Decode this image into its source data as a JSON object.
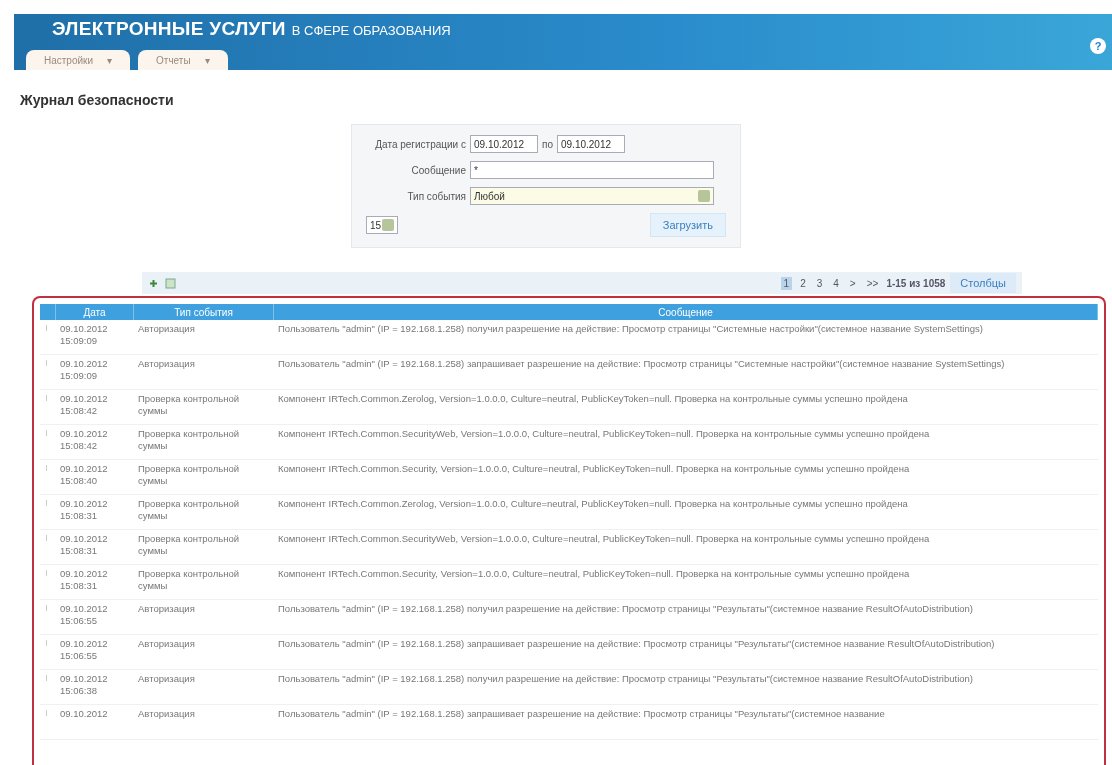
{
  "header": {
    "title_bold": "ЭЛЕКТРОННЫЕ УСЛУГИ",
    "title_rest": "В СФЕРЕ ОБРАЗОВАНИЯ",
    "help": "?"
  },
  "menu": [
    {
      "label": "Настройки",
      "caret": "▾"
    },
    {
      "label": "Отчеты",
      "caret": "▾"
    }
  ],
  "page_title": "Журнал безопасности",
  "filter": {
    "date_label": "Дата регистрации с",
    "date_from": "09.10.2012",
    "date_to_label": "по",
    "date_to": "09.10.2012",
    "message_label": "Сообщение",
    "message_value": "*",
    "type_label": "Тип события",
    "type_value": "Любой",
    "page_size": "15",
    "load_button": "Загрузить"
  },
  "pager": {
    "pages": [
      {
        "label": "1",
        "selected": true
      },
      {
        "label": "2",
        "selected": false
      },
      {
        "label": "3",
        "selected": false
      },
      {
        "label": "4",
        "selected": false
      }
    ],
    "next": ">",
    "last": ">>",
    "range": "1-15 из 1058",
    "columns_button": "Столбцы"
  },
  "table": {
    "columns": [
      "Дата",
      "Тип события",
      "Сообщение"
    ],
    "rows": [
      {
        "date": "09.10.2012 15:09:09",
        "type": "Авторизация",
        "message": "Пользователь \"admin\" (IP = 192.168.1.258) получил разрешение на действие: Просмотр страницы \"Системные настройки\"(системное название SystemSettings)"
      },
      {
        "date": "09.10.2012 15:09:09",
        "type": "Авторизация",
        "message": "Пользователь \"admin\" (IP = 192.168.1.258) запрашивает разрешение на действие: Просмотр страницы \"Системные настройки\"(системное название SystemSettings)"
      },
      {
        "date": "09.10.2012 15:08:42",
        "type": "Проверка контрольной суммы",
        "message": "Компонент IRTech.Common.Zerolog, Version=1.0.0.0, Culture=neutral, PublicKeyToken=null. Проверка на контрольные суммы успешно пройдена"
      },
      {
        "date": "09.10.2012 15:08:42",
        "type": "Проверка контрольной суммы",
        "message": "Компонент IRTech.Common.SecurityWeb, Version=1.0.0.0, Culture=neutral, PublicKeyToken=null. Проверка на контрольные суммы успешно пройдена"
      },
      {
        "date": "09.10.2012 15:08:40",
        "type": "Проверка контрольной суммы",
        "message": "Компонент IRTech.Common.Security, Version=1.0.0.0, Culture=neutral, PublicKeyToken=null. Проверка на контрольные суммы успешно пройдена"
      },
      {
        "date": "09.10.2012 15:08:31",
        "type": "Проверка контрольной суммы",
        "message": "Компонент IRTech.Common.Zerolog, Version=1.0.0.0, Culture=neutral, PublicKeyToken=null. Проверка на контрольные суммы успешно пройдена"
      },
      {
        "date": "09.10.2012 15:08:31",
        "type": "Проверка контрольной суммы",
        "message": "Компонент IRTech.Common.SecurityWeb, Version=1.0.0.0, Culture=neutral, PublicKeyToken=null. Проверка на контрольные суммы успешно пройдена"
      },
      {
        "date": "09.10.2012 15:08:31",
        "type": "Проверка контрольной суммы",
        "message": "Компонент IRTech.Common.Security, Version=1.0.0.0, Culture=neutral, PublicKeyToken=null. Проверка на контрольные суммы успешно пройдена"
      },
      {
        "date": "09.10.2012 15:06:55",
        "type": "Авторизация",
        "message": "Пользователь \"admin\" (IP = 192.168.1.258) получил разрешение на действие: Просмотр страницы \"Результаты\"(системное название ResultOfAutoDistribution)"
      },
      {
        "date": "09.10.2012 15:06:55",
        "type": "Авторизация",
        "message": "Пользователь \"admin\" (IP = 192.168.1.258) запрашивает разрешение на действие: Просмотр страницы \"Результаты\"(системное название ResultOfAutoDistribution)"
      },
      {
        "date": "09.10.2012 15:06:38",
        "type": "Авторизация",
        "message": "Пользователь \"admin\" (IP = 192.168.1.258) получил разрешение на действие: Просмотр страницы \"Результаты\"(системное название ResultOfAutoDistribution)"
      },
      {
        "date": "09.10.2012",
        "type": "Авторизация",
        "message": "Пользователь \"admin\" (IP = 192.168.1.258) запрашивает разрешение на действие: Просмотр страницы \"Результаты\"(системное название"
      }
    ]
  }
}
